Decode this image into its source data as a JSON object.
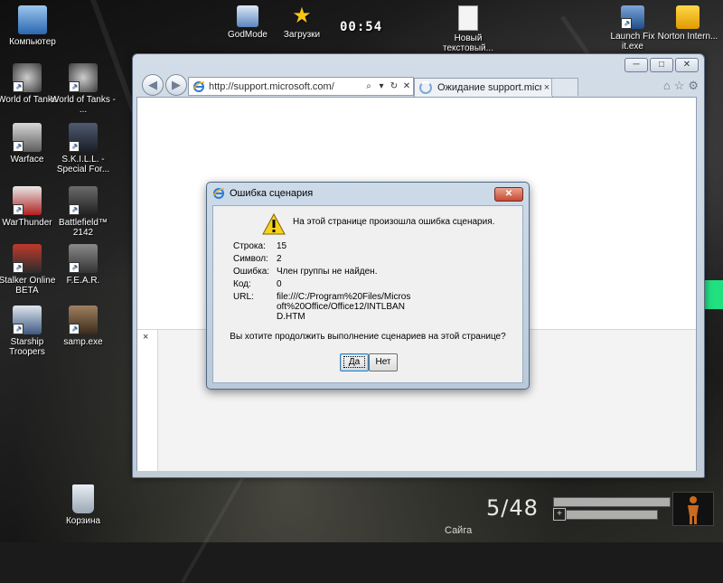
{
  "desktop": {
    "clock": "00:54",
    "icons": [
      {
        "name": "computer",
        "label": "Компьютер"
      },
      {
        "name": "world-of-tanks",
        "label": "World of Tanks"
      },
      {
        "name": "world-of-tanks-2",
        "label": "World of Tanks - ..."
      },
      {
        "name": "warface",
        "label": "Warface"
      },
      {
        "name": "skill",
        "label": "S.K.I.L.L. - Special For..."
      },
      {
        "name": "warthunder",
        "label": "WarThunder"
      },
      {
        "name": "battlefield",
        "label": "Battlefield™ 2142"
      },
      {
        "name": "stalker",
        "label": "Stalker Online BETA"
      },
      {
        "name": "fear",
        "label": "F.E.A.R."
      },
      {
        "name": "starship",
        "label": "Starship Troopers"
      },
      {
        "name": "samp",
        "label": "samp.exe"
      },
      {
        "name": "recycle-bin",
        "label": "Корзина"
      },
      {
        "name": "godmode",
        "label": "GodMode"
      },
      {
        "name": "downloads",
        "label": "Загрузки"
      },
      {
        "name": "new-text",
        "label": "Новый текстовый..."
      },
      {
        "name": "launch-fixit",
        "label": "Launch Fix it.exe"
      },
      {
        "name": "norton",
        "label": "Norton Intern..."
      }
    ],
    "hud": {
      "ammo": "5/48",
      "map": "Сайга"
    },
    "colors": {
      "accent_green": "#20e080"
    }
  },
  "browser": {
    "address": "http://support.microsoft.com/",
    "tab_label": "Ожидание support.micros...",
    "tab_close": "×",
    "pane_close": "×",
    "window_buttons": {
      "minimize": "─",
      "maximize": "□",
      "close": "✕"
    },
    "nav": {
      "back": "◀",
      "forward": "▶"
    },
    "address_controls": {
      "search": "⌕",
      "dropdown": "▾",
      "refresh": "↻",
      "stop": "✕"
    },
    "command_icons": {
      "home": "⌂",
      "favorites": "☆",
      "tools": "⚙"
    }
  },
  "dialog": {
    "title": "Ошибка сценария",
    "close": "✕",
    "message": "На этой странице произошла ошибка сценария.",
    "details": [
      {
        "label": "Строка:",
        "value": "15"
      },
      {
        "label": "Символ:",
        "value": "2"
      },
      {
        "label": "Ошибка:",
        "value": "Член группы не найден."
      },
      {
        "label": "Код:",
        "value": "0"
      },
      {
        "label": "URL:",
        "value": "file:///C:/Program%20Files/Microsoft%20Office/Office12/INTLBAND.HTM"
      }
    ],
    "question": "Вы хотите продолжить выполнение сценариев на этой странице?",
    "yes_label": "Да",
    "no_label": "Нет"
  }
}
